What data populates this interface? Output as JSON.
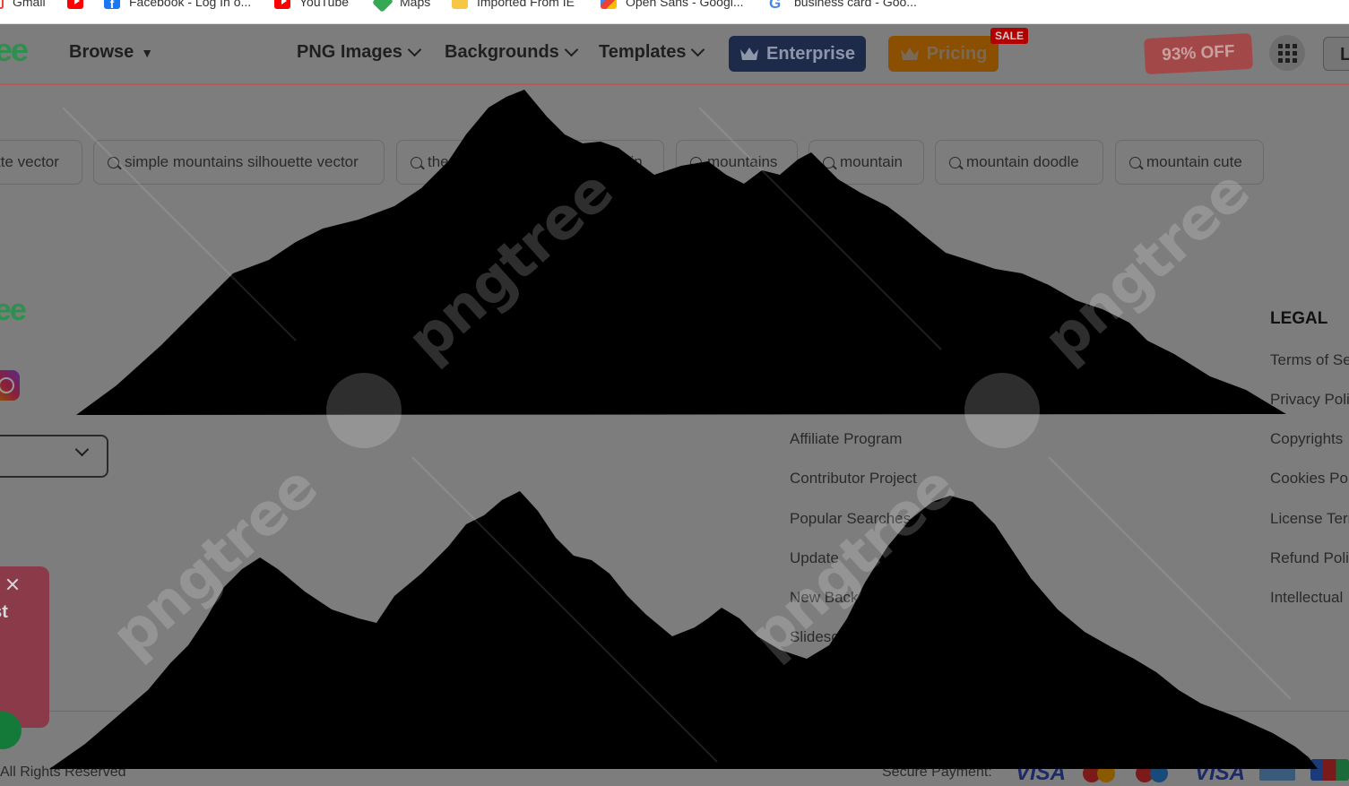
{
  "bookmarks": [
    {
      "label": "Gmail",
      "icon": "gmail-icon"
    },
    {
      "label": "",
      "icon": "youtube-icon"
    },
    {
      "label": "Facebook - Log In o...",
      "icon": "facebook-icon"
    },
    {
      "label": "YouTube",
      "icon": "youtube-icon"
    },
    {
      "label": "Maps",
      "icon": "maps-icon"
    },
    {
      "label": "Imported From IE",
      "icon": "folder-icon"
    },
    {
      "label": "Open Sans - Googl...",
      "icon": "google-fonts-icon"
    },
    {
      "label": "business card - Goo...",
      "icon": "google-icon"
    }
  ],
  "nav": {
    "logo_fragment": "ee",
    "browse": "Browse",
    "png_images": "PNG Images",
    "backgrounds": "Backgrounds",
    "templates": "Templates",
    "enterprise": "Enterprise",
    "pricing": "Pricing",
    "sale": "SALE",
    "discount": "93% OFF",
    "login_fragment": "L"
  },
  "chips": [
    "tte vector",
    "simple mountains silhouette vector",
    "the m",
    "ain",
    "mountains",
    "mountain",
    "mountain doodle",
    "mountain cute"
  ],
  "footer": {
    "logo_fragment": "ee",
    "links": [
      "Affiliate Program",
      "Contributor Project",
      "Popular Searches",
      "Update",
      "New Back",
      "Slidesc"
    ],
    "legal_heading": "LEGAL",
    "legal_links": [
      "Terms of Se",
      "Privacy Poli",
      "Copyrights",
      "Cookies Pol",
      "License Terr",
      "Refund Poli",
      "Intellectual"
    ],
    "copyright": "All Rights Reserved",
    "secure_payment": "Secure Payment:",
    "visa": "VISA"
  },
  "promo": {
    "text": "est"
  },
  "watermark": "pngtree",
  "colors": {
    "overlay_dim": "#7d7d7d",
    "silhouette": "#000000",
    "brand_green": "#2e8f4e",
    "enterprise_bg": "#1e2a4a",
    "pricing_bg": "#8a4f00",
    "sale_red": "#b10000"
  }
}
